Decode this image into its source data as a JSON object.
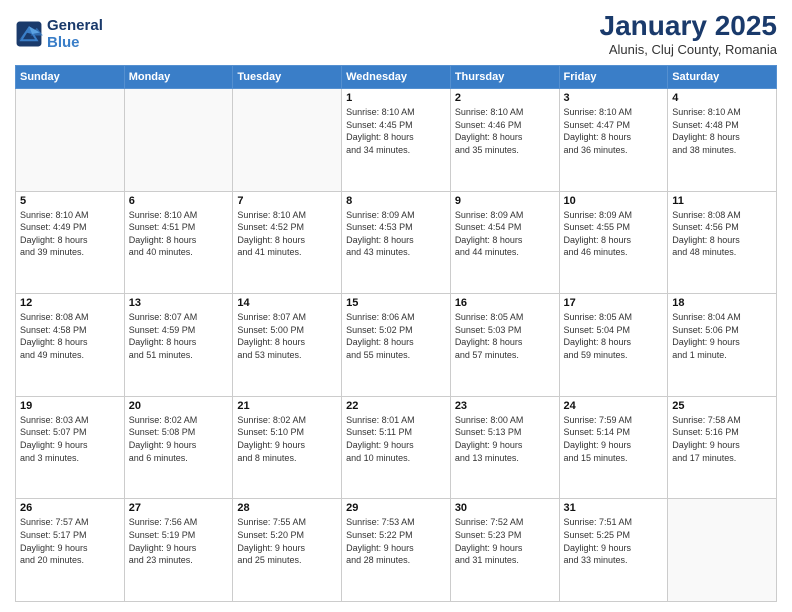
{
  "logo": {
    "line1": "General",
    "line2": "Blue"
  },
  "header": {
    "month": "January 2025",
    "location": "Alunis, Cluj County, Romania"
  },
  "weekdays": [
    "Sunday",
    "Monday",
    "Tuesday",
    "Wednesday",
    "Thursday",
    "Friday",
    "Saturday"
  ],
  "weeks": [
    [
      {
        "day": "",
        "info": ""
      },
      {
        "day": "",
        "info": ""
      },
      {
        "day": "",
        "info": ""
      },
      {
        "day": "1",
        "info": "Sunrise: 8:10 AM\nSunset: 4:45 PM\nDaylight: 8 hours\nand 34 minutes."
      },
      {
        "day": "2",
        "info": "Sunrise: 8:10 AM\nSunset: 4:46 PM\nDaylight: 8 hours\nand 35 minutes."
      },
      {
        "day": "3",
        "info": "Sunrise: 8:10 AM\nSunset: 4:47 PM\nDaylight: 8 hours\nand 36 minutes."
      },
      {
        "day": "4",
        "info": "Sunrise: 8:10 AM\nSunset: 4:48 PM\nDaylight: 8 hours\nand 38 minutes."
      }
    ],
    [
      {
        "day": "5",
        "info": "Sunrise: 8:10 AM\nSunset: 4:49 PM\nDaylight: 8 hours\nand 39 minutes."
      },
      {
        "day": "6",
        "info": "Sunrise: 8:10 AM\nSunset: 4:51 PM\nDaylight: 8 hours\nand 40 minutes."
      },
      {
        "day": "7",
        "info": "Sunrise: 8:10 AM\nSunset: 4:52 PM\nDaylight: 8 hours\nand 41 minutes."
      },
      {
        "day": "8",
        "info": "Sunrise: 8:09 AM\nSunset: 4:53 PM\nDaylight: 8 hours\nand 43 minutes."
      },
      {
        "day": "9",
        "info": "Sunrise: 8:09 AM\nSunset: 4:54 PM\nDaylight: 8 hours\nand 44 minutes."
      },
      {
        "day": "10",
        "info": "Sunrise: 8:09 AM\nSunset: 4:55 PM\nDaylight: 8 hours\nand 46 minutes."
      },
      {
        "day": "11",
        "info": "Sunrise: 8:08 AM\nSunset: 4:56 PM\nDaylight: 8 hours\nand 48 minutes."
      }
    ],
    [
      {
        "day": "12",
        "info": "Sunrise: 8:08 AM\nSunset: 4:58 PM\nDaylight: 8 hours\nand 49 minutes."
      },
      {
        "day": "13",
        "info": "Sunrise: 8:07 AM\nSunset: 4:59 PM\nDaylight: 8 hours\nand 51 minutes."
      },
      {
        "day": "14",
        "info": "Sunrise: 8:07 AM\nSunset: 5:00 PM\nDaylight: 8 hours\nand 53 minutes."
      },
      {
        "day": "15",
        "info": "Sunrise: 8:06 AM\nSunset: 5:02 PM\nDaylight: 8 hours\nand 55 minutes."
      },
      {
        "day": "16",
        "info": "Sunrise: 8:05 AM\nSunset: 5:03 PM\nDaylight: 8 hours\nand 57 minutes."
      },
      {
        "day": "17",
        "info": "Sunrise: 8:05 AM\nSunset: 5:04 PM\nDaylight: 8 hours\nand 59 minutes."
      },
      {
        "day": "18",
        "info": "Sunrise: 8:04 AM\nSunset: 5:06 PM\nDaylight: 9 hours\nand 1 minute."
      }
    ],
    [
      {
        "day": "19",
        "info": "Sunrise: 8:03 AM\nSunset: 5:07 PM\nDaylight: 9 hours\nand 3 minutes."
      },
      {
        "day": "20",
        "info": "Sunrise: 8:02 AM\nSunset: 5:08 PM\nDaylight: 9 hours\nand 6 minutes."
      },
      {
        "day": "21",
        "info": "Sunrise: 8:02 AM\nSunset: 5:10 PM\nDaylight: 9 hours\nand 8 minutes."
      },
      {
        "day": "22",
        "info": "Sunrise: 8:01 AM\nSunset: 5:11 PM\nDaylight: 9 hours\nand 10 minutes."
      },
      {
        "day": "23",
        "info": "Sunrise: 8:00 AM\nSunset: 5:13 PM\nDaylight: 9 hours\nand 13 minutes."
      },
      {
        "day": "24",
        "info": "Sunrise: 7:59 AM\nSunset: 5:14 PM\nDaylight: 9 hours\nand 15 minutes."
      },
      {
        "day": "25",
        "info": "Sunrise: 7:58 AM\nSunset: 5:16 PM\nDaylight: 9 hours\nand 17 minutes."
      }
    ],
    [
      {
        "day": "26",
        "info": "Sunrise: 7:57 AM\nSunset: 5:17 PM\nDaylight: 9 hours\nand 20 minutes."
      },
      {
        "day": "27",
        "info": "Sunrise: 7:56 AM\nSunset: 5:19 PM\nDaylight: 9 hours\nand 23 minutes."
      },
      {
        "day": "28",
        "info": "Sunrise: 7:55 AM\nSunset: 5:20 PM\nDaylight: 9 hours\nand 25 minutes."
      },
      {
        "day": "29",
        "info": "Sunrise: 7:53 AM\nSunset: 5:22 PM\nDaylight: 9 hours\nand 28 minutes."
      },
      {
        "day": "30",
        "info": "Sunrise: 7:52 AM\nSunset: 5:23 PM\nDaylight: 9 hours\nand 31 minutes."
      },
      {
        "day": "31",
        "info": "Sunrise: 7:51 AM\nSunset: 5:25 PM\nDaylight: 9 hours\nand 33 minutes."
      },
      {
        "day": "",
        "info": ""
      }
    ]
  ]
}
